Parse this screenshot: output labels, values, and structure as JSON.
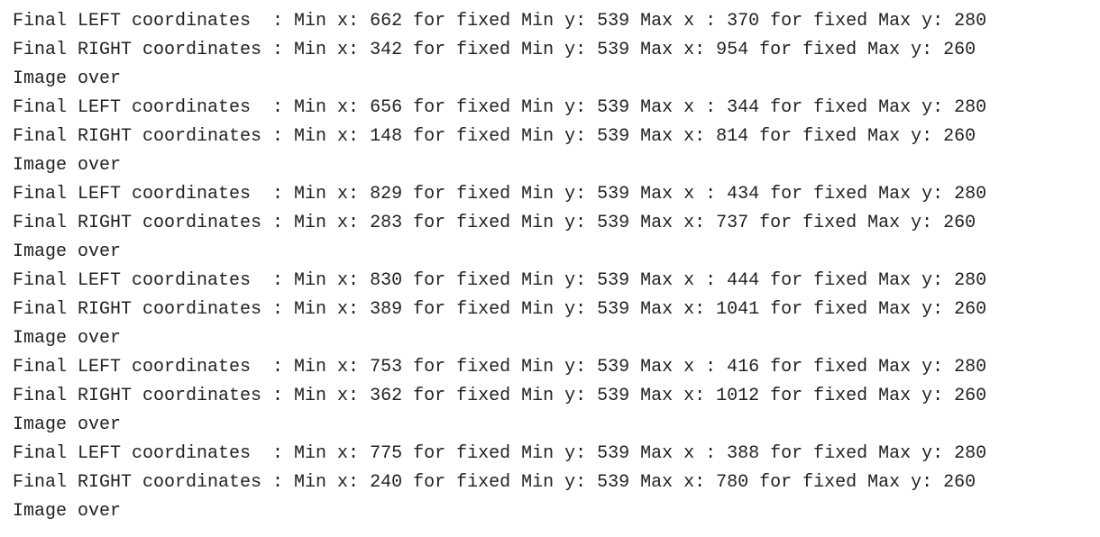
{
  "console": {
    "text_color": "#222222",
    "background_color": "#ffffff",
    "lines": [
      "Final LEFT coordinates  : Min x: 662 for fixed Min y: 539 Max x : 370 for fixed Max y: 280",
      "Final RIGHT coordinates : Min x: 342 for fixed Min y: 539 Max x: 954 for fixed Max y: 260",
      "Image over",
      "Final LEFT coordinates  : Min x: 656 for fixed Min y: 539 Max x : 344 for fixed Max y: 280",
      "Final RIGHT coordinates : Min x: 148 for fixed Min y: 539 Max x: 814 for fixed Max y: 260",
      "Image over",
      "Final LEFT coordinates  : Min x: 829 for fixed Min y: 539 Max x : 434 for fixed Max y: 280",
      "Final RIGHT coordinates : Min x: 283 for fixed Min y: 539 Max x: 737 for fixed Max y: 260",
      "Image over",
      "Final LEFT coordinates  : Min x: 830 for fixed Min y: 539 Max x : 444 for fixed Max y: 280",
      "Final RIGHT coordinates : Min x: 389 for fixed Min y: 539 Max x: 1041 for fixed Max y: 260",
      "Image over",
      "Final LEFT coordinates  : Min x: 753 for fixed Min y: 539 Max x : 416 for fixed Max y: 280",
      "Final RIGHT coordinates : Min x: 362 for fixed Min y: 539 Max x: 1012 for fixed Max y: 260",
      "Image over",
      "Final LEFT coordinates  : Min x: 775 for fixed Min y: 539 Max x : 388 for fixed Max y: 280",
      "Final RIGHT coordinates : Min x: 240 for fixed Min y: 539 Max x: 780 for fixed Max y: 260",
      "Image over"
    ]
  }
}
